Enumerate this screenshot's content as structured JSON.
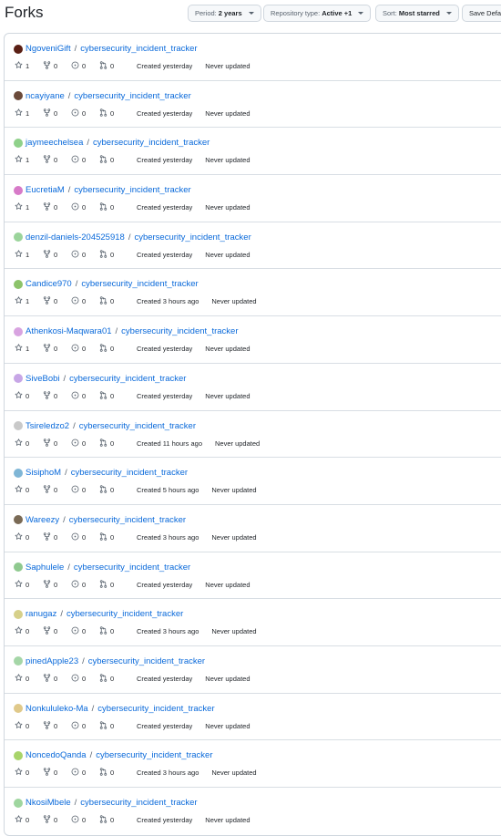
{
  "page": {
    "title": "Forks"
  },
  "toolbar": {
    "period": {
      "label": "Period:",
      "value": "2 years"
    },
    "repo_type": {
      "label": "Repository type:",
      "value": "Active +1"
    },
    "sort": {
      "label": "Sort:",
      "value": "Most starred"
    },
    "save": {
      "label": "Save Defau"
    }
  },
  "colors": {
    "link": "#0969da",
    "border": "#d0d7de",
    "muted": "#59636e"
  },
  "forks": [
    {
      "owner": "NgoveniGift",
      "repo": "cybersecurity_incident_tracker",
      "stars": "1",
      "forks": "0",
      "issues": "0",
      "prs": "0",
      "created": "Created yesterday",
      "updated": "Never updated",
      "avatar_color": "#5a1f14"
    },
    {
      "owner": "ncayiyane",
      "repo": "cybersecurity_incident_tracker",
      "stars": "1",
      "forks": "0",
      "issues": "0",
      "prs": "0",
      "created": "Created yesterday",
      "updated": "Never updated",
      "avatar_color": "#6b4a3a"
    },
    {
      "owner": "jaymeechelsea",
      "repo": "cybersecurity_incident_tracker",
      "stars": "1",
      "forks": "0",
      "issues": "0",
      "prs": "0",
      "created": "Created yesterday",
      "updated": "Never updated",
      "avatar_color": "#8fd18a"
    },
    {
      "owner": "EucretiaM",
      "repo": "cybersecurity_incident_tracker",
      "stars": "1",
      "forks": "0",
      "issues": "0",
      "prs": "0",
      "created": "Created yesterday",
      "updated": "Never updated",
      "avatar_color": "#d77ac8"
    },
    {
      "owner": "denzil-daniels-204525918",
      "repo": "cybersecurity_incident_tracker",
      "stars": "1",
      "forks": "0",
      "issues": "0",
      "prs": "0",
      "created": "Created yesterday",
      "updated": "Never updated",
      "avatar_color": "#9bd49b"
    },
    {
      "owner": "Candice970",
      "repo": "cybersecurity_incident_tracker",
      "stars": "1",
      "forks": "0",
      "issues": "0",
      "prs": "0",
      "created": "Created 3 hours ago",
      "updated": "Never updated",
      "avatar_color": "#8cc36a"
    },
    {
      "owner": "Athenkosi-Maqwara01",
      "repo": "cybersecurity_incident_tracker",
      "stars": "1",
      "forks": "0",
      "issues": "0",
      "prs": "0",
      "created": "Created yesterday",
      "updated": "Never updated",
      "avatar_color": "#d8a3e0"
    },
    {
      "owner": "SiveBobi",
      "repo": "cybersecurity_incident_tracker",
      "stars": "0",
      "forks": "0",
      "issues": "0",
      "prs": "0",
      "created": "Created yesterday",
      "updated": "Never updated",
      "avatar_color": "#c7a6e6"
    },
    {
      "owner": "Tsireledzo2",
      "repo": "cybersecurity_incident_tracker",
      "stars": "0",
      "forks": "0",
      "issues": "0",
      "prs": "0",
      "created": "Created 11 hours ago",
      "updated": "Never updated",
      "avatar_color": "#c9c9c9"
    },
    {
      "owner": "SisiphoM",
      "repo": "cybersecurity_incident_tracker",
      "stars": "0",
      "forks": "0",
      "issues": "0",
      "prs": "0",
      "created": "Created 5 hours ago",
      "updated": "Never updated",
      "avatar_color": "#7fb6d6"
    },
    {
      "owner": "Wareezy",
      "repo": "cybersecurity_incident_tracker",
      "stars": "0",
      "forks": "0",
      "issues": "0",
      "prs": "0",
      "created": "Created 3 hours ago",
      "updated": "Never updated",
      "avatar_color": "#7a6a55"
    },
    {
      "owner": "Saphulele",
      "repo": "cybersecurity_incident_tracker",
      "stars": "0",
      "forks": "0",
      "issues": "0",
      "prs": "0",
      "created": "Created yesterday",
      "updated": "Never updated",
      "avatar_color": "#8fc98f"
    },
    {
      "owner": "ranugaz",
      "repo": "cybersecurity_incident_tracker",
      "stars": "0",
      "forks": "0",
      "issues": "0",
      "prs": "0",
      "created": "Created 3 hours ago",
      "updated": "Never updated",
      "avatar_color": "#d6d08a"
    },
    {
      "owner": "pinedApple23",
      "repo": "cybersecurity_incident_tracker",
      "stars": "0",
      "forks": "0",
      "issues": "0",
      "prs": "0",
      "created": "Created yesterday",
      "updated": "Never updated",
      "avatar_color": "#a5d6a7"
    },
    {
      "owner": "Nonkululeko-Ma",
      "repo": "cybersecurity_incident_tracker",
      "stars": "0",
      "forks": "0",
      "issues": "0",
      "prs": "0",
      "created": "Created yesterday",
      "updated": "Never updated",
      "avatar_color": "#e0c98a"
    },
    {
      "owner": "NoncedoQanda",
      "repo": "cybersecurity_incident_tracker",
      "stars": "0",
      "forks": "0",
      "issues": "0",
      "prs": "0",
      "created": "Created 3 hours ago",
      "updated": "Never updated",
      "avatar_color": "#a8d46a"
    },
    {
      "owner": "NkosiMbele",
      "repo": "cybersecurity_incident_tracker",
      "stars": "0",
      "forks": "0",
      "issues": "0",
      "prs": "0",
      "created": "Created yesterday",
      "updated": "Never updated",
      "avatar_color": "#9fd69f"
    }
  ]
}
